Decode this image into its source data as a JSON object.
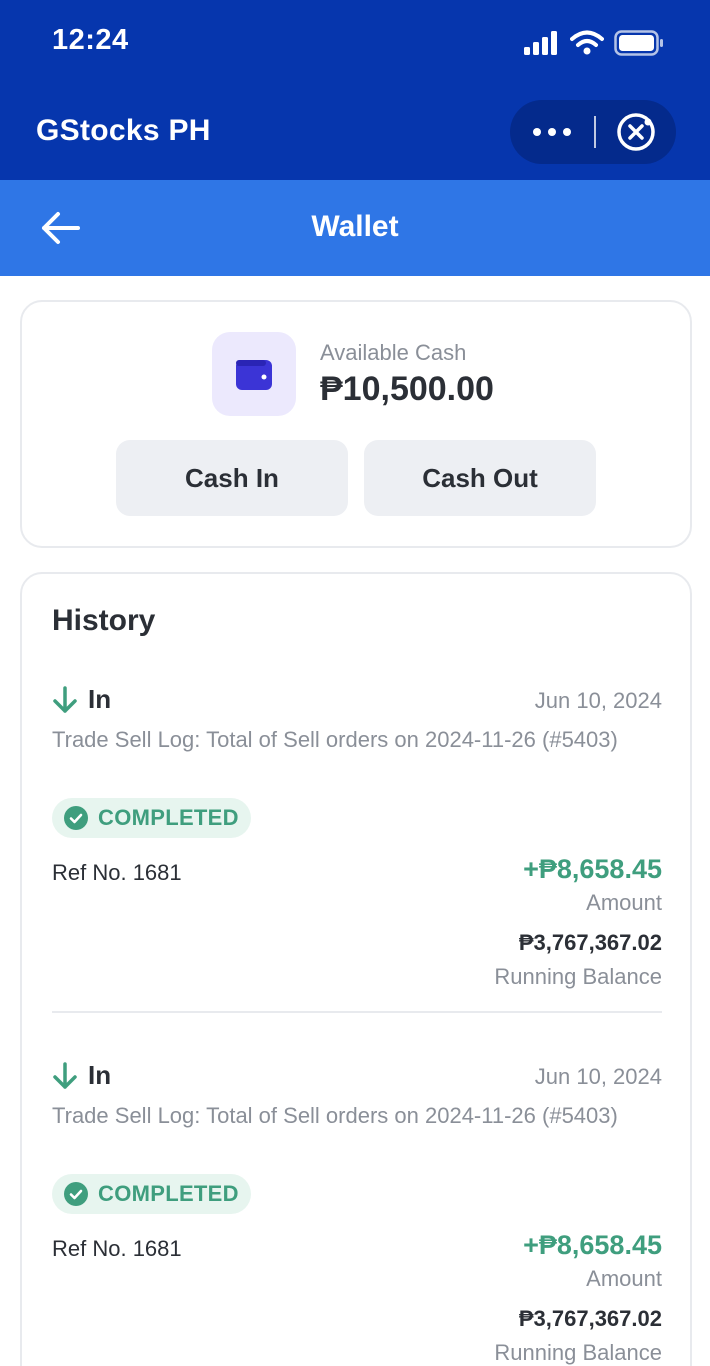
{
  "status_bar": {
    "time": "12:24"
  },
  "app_header": {
    "title": "GStocks PH"
  },
  "nav": {
    "title": "Wallet"
  },
  "wallet": {
    "cash_label": "Available Cash",
    "cash_value": "₱10,500.00",
    "cash_in_label": "Cash In",
    "cash_out_label": "Cash Out"
  },
  "history": {
    "title": "History",
    "items": [
      {
        "direction": "In",
        "date": "Jun 10, 2024",
        "description": "Trade Sell Log: Total of Sell orders on 2024-11-26 (#5403)",
        "status": "COMPLETED",
        "ref": "Ref No. 1681",
        "amount": "+₱8,658.45",
        "amount_label": "Amount",
        "balance": "₱3,767,367.02",
        "balance_label": "Running Balance"
      },
      {
        "direction": "In",
        "date": "Jun 10, 2024",
        "description": "Trade Sell Log: Total of Sell orders on 2024-11-26 (#5403)",
        "status": "COMPLETED",
        "ref": "Ref No. 1681",
        "amount": "+₱8,658.45",
        "amount_label": "Amount",
        "balance": "₱3,767,367.02",
        "balance_label": "Running Balance"
      }
    ]
  },
  "colors": {
    "header": "#0636ad",
    "nav": "#2f76e6",
    "success": "#3f9e7e",
    "wallet_icon": "#3b34d6"
  }
}
